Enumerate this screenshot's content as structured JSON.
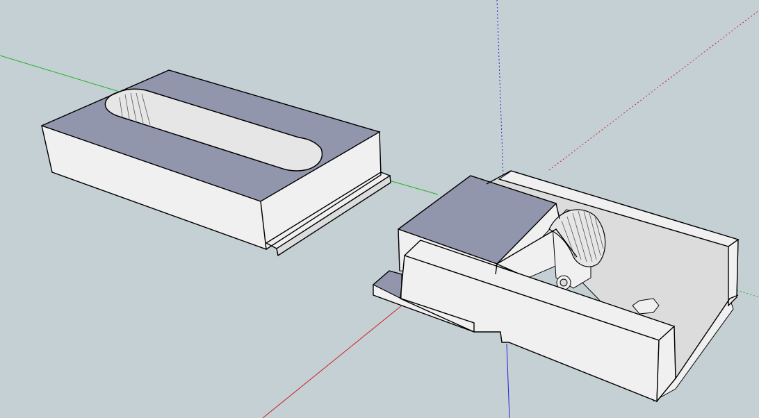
{
  "viewport": {
    "background_color": "#c5d0d5",
    "edge_color": "#000000",
    "axes": {
      "red": "#d02020",
      "green": "#20b020",
      "blue": "#2020d0"
    },
    "face_colors": {
      "top_face": "#9196ad",
      "side_face": "#f0f0f0",
      "shadow_face": "#dcdcdc",
      "slot_wall": "#e6e6e6"
    }
  },
  "objects": [
    {
      "name": "slotted-block"
    },
    {
      "name": "slide-clamp-assembly"
    }
  ]
}
